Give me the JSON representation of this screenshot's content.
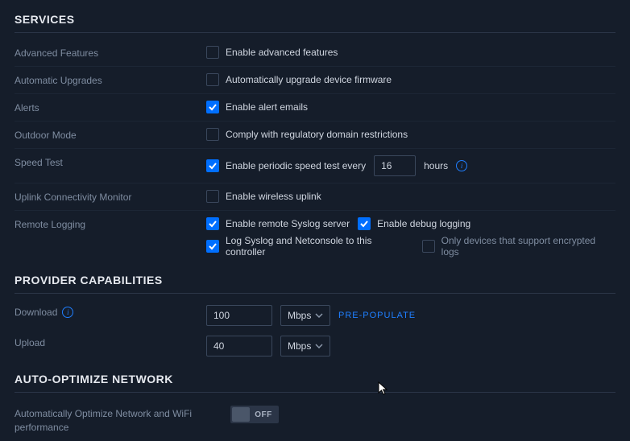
{
  "services": {
    "header": "SERVICES",
    "advanced_features": {
      "label": "Advanced Features",
      "checkbox_label": "Enable advanced features",
      "checked": false
    },
    "automatic_upgrades": {
      "label": "Automatic Upgrades",
      "checkbox_label": "Automatically upgrade device firmware",
      "checked": false
    },
    "alerts": {
      "label": "Alerts",
      "checkbox_label": "Enable alert emails",
      "checked": true
    },
    "outdoor_mode": {
      "label": "Outdoor Mode",
      "checkbox_label": "Comply with regulatory domain restrictions",
      "checked": false
    },
    "speed_test": {
      "label": "Speed Test",
      "checkbox_label": "Enable periodic speed test every",
      "checked": true,
      "value": "16",
      "unit": "hours"
    },
    "uplink": {
      "label": "Uplink Connectivity Monitor",
      "checkbox_label": "Enable wireless uplink",
      "checked": false
    },
    "remote_logging": {
      "label": "Remote Logging",
      "syslog": {
        "label": "Enable remote Syslog server",
        "checked": true
      },
      "debug": {
        "label": "Enable debug logging",
        "checked": true
      },
      "log_netconsole": {
        "label": "Log Syslog and Netconsole to this controller",
        "checked": true
      },
      "encrypted_only": {
        "label": "Only devices that support encrypted logs",
        "checked": false
      }
    }
  },
  "provider": {
    "header": "PROVIDER CAPABILITIES",
    "download": {
      "label": "Download",
      "value": "100",
      "unit": "Mbps"
    },
    "upload": {
      "label": "Upload",
      "value": "40",
      "unit": "Mbps"
    },
    "prepopulate": "PRE-POPULATE"
  },
  "auto_optimize": {
    "header": "AUTO-OPTIMIZE NETWORK",
    "label": "Automatically Optimize Network and WiFi performance",
    "state": "OFF"
  }
}
